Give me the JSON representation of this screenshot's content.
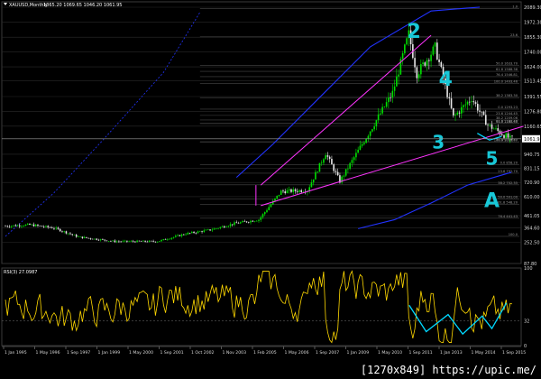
{
  "header": {
    "symbol_text": "XAUUSD,Monthly",
    "ohlc_text": "1065.20  1069.65  1046.20  1061.95"
  },
  "colors": {
    "bg": "#000000",
    "grid": "#2b2b2b",
    "bull": "#00e000",
    "bear": "#e8e8e8",
    "trendline": "#ff33ff",
    "band": "#2233ff",
    "rsi": "#ffd800",
    "annotation": "#18c8d8",
    "projection": "#00d8ff",
    "axis_text": "#d8d8d8",
    "price_tag_bg": "#ffffff",
    "price_tag_fg": "#000000"
  },
  "price_axis": {
    "labels": [
      "2089.30",
      "1972.30",
      "1855.30",
      "1740.00",
      "1624.00",
      "1513.45",
      "1391.55",
      "1276.80",
      "1160.65",
      "940.75",
      "831.15",
      "720.90",
      "610.00",
      "461.05",
      "364.60",
      "252.50",
      "87.80"
    ],
    "current_tag": "1061.95"
  },
  "fib_labels": [
    "1.0",
    "23.6",
    "38.2 1383.30",
    "50.0 1633.70",
    "61.8 1588.38",
    "76.4 1546.81",
    "100.0 1493.46",
    "0.0 1293.23",
    "23.6 1244.45",
    "38.2 1209.06",
    "50.0 1180.60",
    "61.8 1182.48",
    "76.4 1038.81",
    "100.0 1035.77",
    "0.0 858.20",
    "23.6 792.70",
    "38.2 702.35",
    "50.0 591.00",
    "61.8 548.20",
    "76.4 441.43",
    "100.0"
  ],
  "time_axis": {
    "labels": [
      "1 Jan 1995",
      "1 May 1996",
      "1 Sep 1997",
      "1 Jan 1999",
      "1 May 2000",
      "1 Sep 2001",
      "1 Oct 2002",
      "1 Nov 2003",
      "1 Feb 2005",
      "1 May 2006",
      "1 Sep 2007",
      "1 Jan 2009",
      "1 May 2010",
      "1 Sep 2011",
      "1 Jan 2013",
      "1 May 2014",
      "1 Sep 2015"
    ]
  },
  "rsi": {
    "label": "RSI(3) 27.0987",
    "axis_labels": [
      "100",
      "32",
      "0"
    ]
  },
  "annotations": [
    "2",
    "4",
    "3",
    "5",
    "A"
  ],
  "watermark": "[1270x849] https://upic.me/",
  "chart_data": {
    "type": "candlestick",
    "symbol": "XAUUSD",
    "timeframe": "Monthly",
    "x_range": [
      "1995-01",
      "2015-10"
    ],
    "y_range": [
      87.8,
      2089.3
    ],
    "last_close": 1061.95,
    "ohlc_last": {
      "open": 1065.2,
      "high": 1069.65,
      "low": 1046.2,
      "close": 1061.95
    },
    "approx_monthly_close_anchors": [
      {
        "x": "1995-01",
        "y": 380
      },
      {
        "x": "1996-01",
        "y": 390
      },
      {
        "x": "1997-01",
        "y": 365
      },
      {
        "x": "1998-01",
        "y": 295
      },
      {
        "x": "1999-07",
        "y": 260
      },
      {
        "x": "2001-04",
        "y": 260
      },
      {
        "x": "2002-06",
        "y": 320
      },
      {
        "x": "2003-06",
        "y": 350
      },
      {
        "x": "2004-06",
        "y": 400
      },
      {
        "x": "2005-06",
        "y": 430
      },
      {
        "x": "2006-05",
        "y": 650
      },
      {
        "x": "2007-06",
        "y": 660
      },
      {
        "x": "2008-03",
        "y": 950
      },
      {
        "x": "2008-10",
        "y": 730
      },
      {
        "x": "2009-12",
        "y": 1100
      },
      {
        "x": "2010-12",
        "y": 1420
      },
      {
        "x": "2011-08",
        "y": 1880
      },
      {
        "x": "2011-12",
        "y": 1570
      },
      {
        "x": "2012-09",
        "y": 1775
      },
      {
        "x": "2013-06",
        "y": 1230
      },
      {
        "x": "2014-03",
        "y": 1380
      },
      {
        "x": "2014-11",
        "y": 1170
      },
      {
        "x": "2015-10",
        "y": 1062
      }
    ],
    "indicators": [
      {
        "name": "RSI",
        "period": 3,
        "last": 27.0987,
        "ylim": [
          0,
          100
        ]
      }
    ],
    "wave_labels": [
      "2",
      "4",
      "3",
      "5",
      "A"
    ]
  }
}
